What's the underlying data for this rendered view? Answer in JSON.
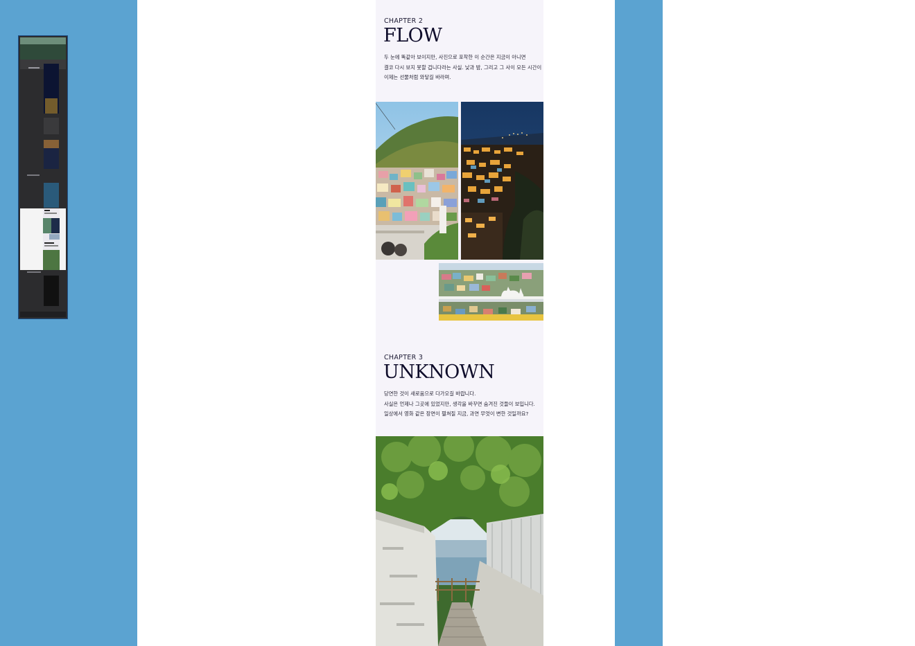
{
  "chapters": [
    {
      "label": "CHAPTER  2",
      "title": "FLOW",
      "lines": [
        "두 눈에 똑같아 보이지만, 사진으로 포착한 이 순간은 지금이 아니면",
        "결코 다시 보지 못할 겁니다라는 사실. 낮과 밤, 그리고 그 사이 모든 시간이",
        "이제는 선물처럼 와닿길 바라며."
      ]
    },
    {
      "label": "CHAPTER  3",
      "title": "UNKNOWN",
      "lines": [
        "당연한 것이 새로움으로 다가오길 바랍니다.",
        "사실은 언제나 그곳에 있었지만, 생각을 바꾸면 숨겨진 것들이 보입니다.",
        "일상에서 영화 같은 장면이 펼쳐질 지금, 과연 무엇이 변한 것일까요?"
      ]
    }
  ],
  "photos": {
    "day_village": "gamcheon-village-day-photo",
    "night_village": "gamcheon-village-night-photo",
    "cat_sculpture": "cat-sculpture-photo",
    "sea_path": "sea-alley-path-photo"
  },
  "colors": {
    "side_panel": "#5ba3d1",
    "column_bg": "#f6f4fa",
    "title": "#0e0c2a",
    "minimap_border": "#1e4f86"
  }
}
